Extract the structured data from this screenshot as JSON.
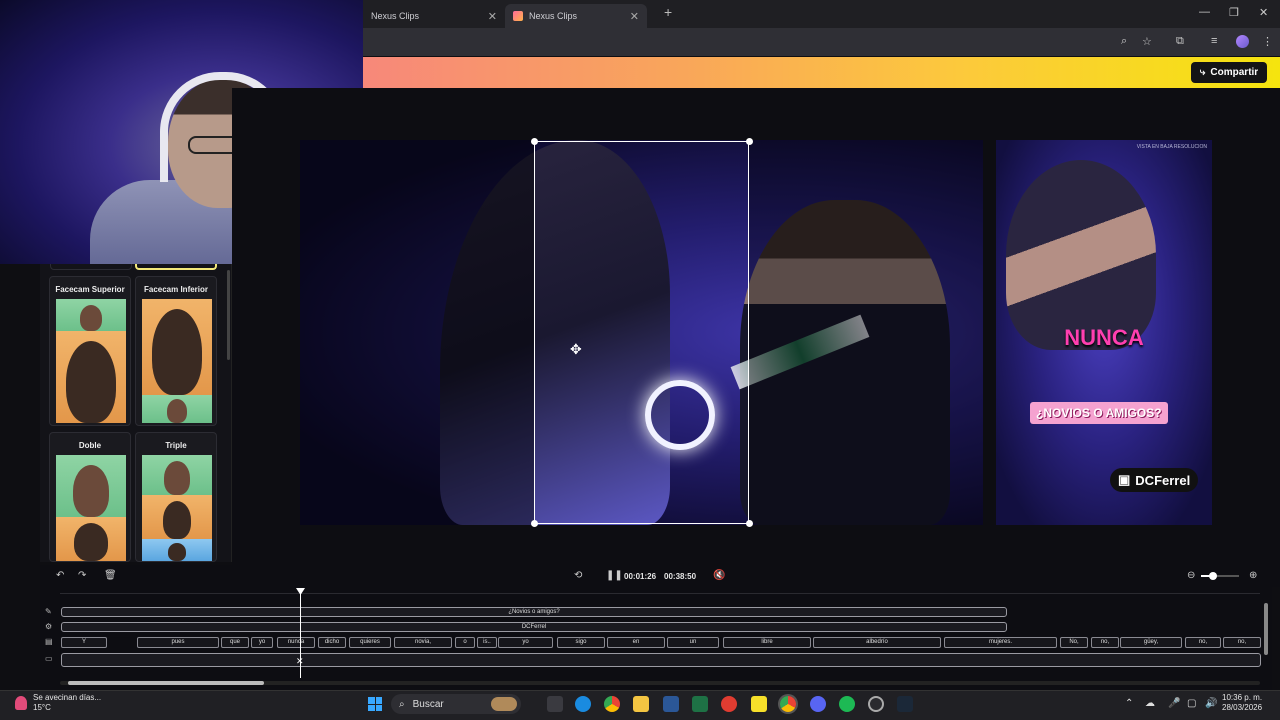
{
  "browser": {
    "tabs": [
      {
        "label": "Nexus Clips"
      },
      {
        "label": "Nexus Clips"
      }
    ],
    "new_tab_glyph": "+"
  },
  "header": {
    "share_label": "Compartir"
  },
  "layouts": [
    {
      "label": "Facecam Superior"
    },
    {
      "label": "Facecam Inferior"
    },
    {
      "label": "Doble"
    },
    {
      "label": "Triple"
    }
  ],
  "preview": {
    "caption_main": "NUNCA",
    "caption_question": "¿NOVIOS O AMIGOS?",
    "channel_name": "DCFerrel",
    "watermark": "VISTA EN BAJA RESOLUCION"
  },
  "playback": {
    "current_time": "00:01:26",
    "total_time": "00:38:50"
  },
  "timeline": {
    "text_clip": "¿Novios o amigos?",
    "name_clip": "DCFerrel",
    "words": [
      "Y",
      "pues",
      "que",
      "yo",
      "nunca",
      "dicho",
      "quieres",
      "novia,",
      "o",
      "is..",
      "yo",
      "sigo",
      "en",
      "un",
      "libre",
      "albedrío",
      "mujeres.",
      "No,",
      "no,",
      "güey,",
      "no,",
      "no,"
    ]
  },
  "taskbar": {
    "weather_text": "Se avecinan días...",
    "temperature": "15°C",
    "search_placeholder": "Buscar",
    "time": "10:36 p. m.",
    "date": "28/03/2026"
  },
  "colors": {
    "accent_pink": "#ff3fb0",
    "header_gradient_start": "#f7887a",
    "header_gradient_end": "#f5e40e"
  }
}
